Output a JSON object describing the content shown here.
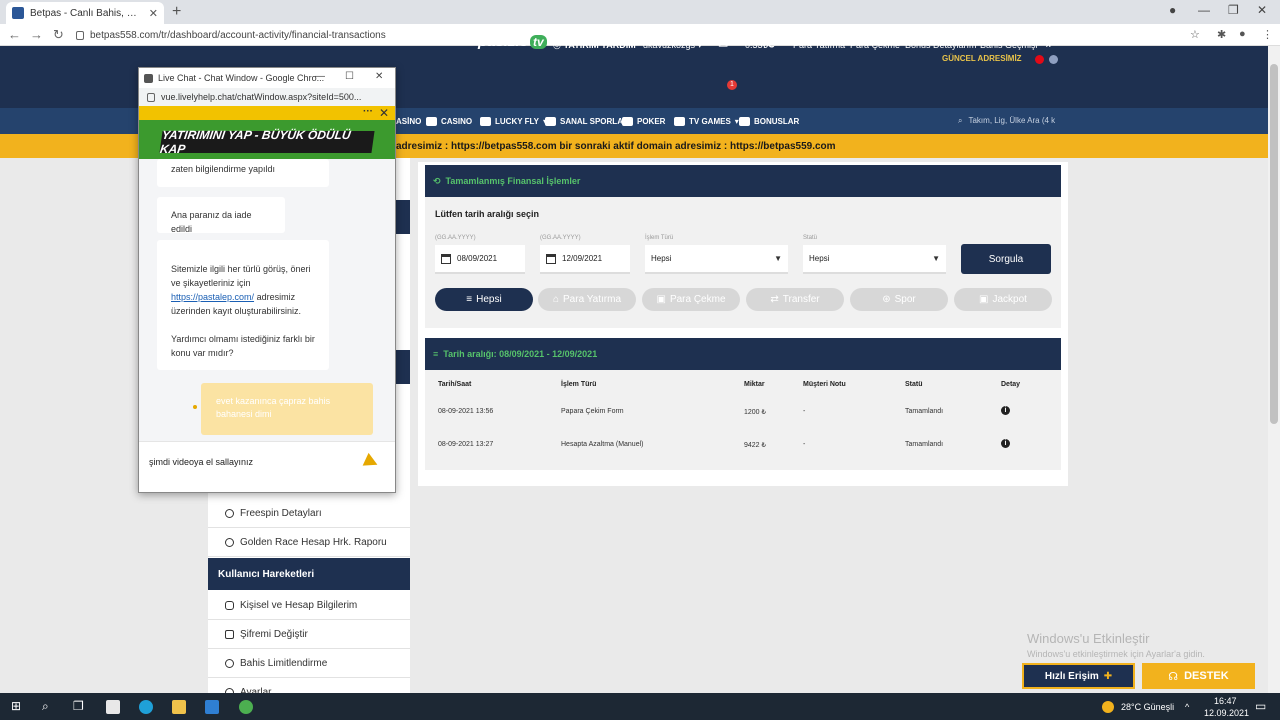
{
  "browser": {
    "tab_title": "Betpas - Canlı Bahis, Canlı Casino",
    "url": "betpas558.com/tr/dashboard/account-activity/financial-transactions"
  },
  "header": {
    "guncel": "GÜNCEL ADRESİMİZ",
    "logo": "pasizle",
    "logo_tv": "tv",
    "yatirim_yardim": "YATIRIM YARDIM",
    "username": "dkavuzkozgs",
    "mail_badge": "1",
    "balance": "0.33₺",
    "links": [
      "Para Yatırma",
      "Para Çekme",
      "Bonus Detaylarım",
      "Bahis Geçmişi"
    ]
  },
  "nav": {
    "items": [
      "ASİNO",
      "CASINO",
      "LUCKY FLY",
      "SANAL SPORLAR",
      "POKER",
      "TV GAMES",
      "BONUSLAR"
    ],
    "search_placeholder": "Takım, Lig, Ülke Ara (4 k"
  },
  "marquee": "adresimiz : https://betpas558.com bir sonraki aktif domain adresimiz : https://betpas559.com",
  "sidebar": {
    "items_top": [
      "Freespin Detayları",
      "Golden Race Hesap Hrk. Raporu"
    ],
    "section": "Kullanıcı Hareketleri",
    "items_bottom": [
      "Kişisel ve Hesap Bilgilerim",
      "Şifremi Değiştir",
      "Bahis Limitlendirme",
      "Ayarlar"
    ]
  },
  "panel": {
    "title": "Tamamlanmış Finansal İşlemler",
    "range_label": "Lütfen tarih aralığı seçin",
    "date_placeholder": "(GG.AA.YYYY)",
    "date_from": "08/09/2021",
    "date_to": "12/09/2021",
    "type_label": "İşlem Türü",
    "type_value": "Hepsi",
    "status_label": "Statü",
    "status_value": "Hepsi",
    "query_button": "Sorgula",
    "filters": [
      "Hepsi",
      "Para Yatırma",
      "Para Çekme",
      "Transfer",
      "Spor",
      "Jackpot"
    ]
  },
  "results": {
    "title": "Tarih aralığı: 08/09/2021 - 12/09/2021",
    "columns": [
      "Tarih/Saat",
      "İşlem Türü",
      "Miktar",
      "Müşteri Notu",
      "Statü",
      "Detay"
    ],
    "rows": [
      {
        "date": "08-09-2021 13:56",
        "type": "Papara Çekim Form",
        "amount": "1200 ₺",
        "note": "-",
        "status": "Tamamlandı"
      },
      {
        "date": "08-09-2021 13:27",
        "type": "Hesapta Azaltma (Manuel)",
        "amount": "9422 ₺",
        "note": "-",
        "status": "Tamamlandı"
      }
    ]
  },
  "watermark": {
    "line1": "Windows'u Etkinleştir",
    "line2": "Windows'u etkinleştirmek için Ayarlar'a gidin."
  },
  "buttons": {
    "hizli": "Hızlı Erişim",
    "destek": "DESTEK"
  },
  "chat": {
    "window_title": "Live Chat - Chat Window - Google Chro...",
    "url": "vue.livelyhelp.chat/chatWindow.aspx?siteId=500...",
    "banner": "YATIRIMINI YAP - BÜYÜK ÖDÜLÜ KAP",
    "msg1": "zaten bilgilendirme yapıldı",
    "msg2": "Ana paranız da iade edildi",
    "msg3_line1": "Sitemizle ilgili her türlü görüş, öneri",
    "msg3_line2": "ve şikayetleriniz için",
    "msg3_link": "https://pastalep.com/",
    "msg3_line3": "adresimiz",
    "msg3_line4": "üzerinden kayıt oluşturabilirsiniz.",
    "msg3_line5": "Yardımcı olmamı istediğiniz farklı bir",
    "msg3_line6": "konu var mıdır?",
    "my_msg_line1": "evet kazanınca çapraz bahis",
    "my_msg_line2": "bahanesi dimi",
    "input_value": "şimdi videoya el sallayınız"
  },
  "taskbar": {
    "weather": "28°C  Güneşli",
    "time": "16:47",
    "date": "12.09.2021"
  }
}
